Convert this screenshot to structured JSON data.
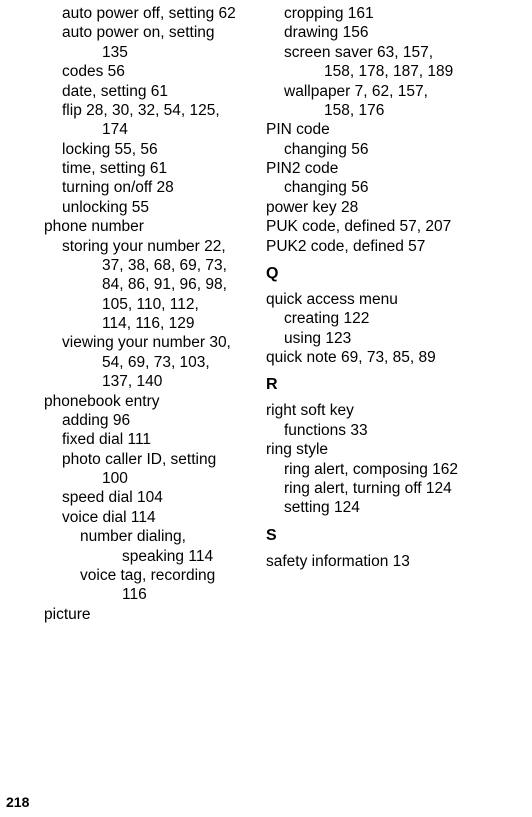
{
  "left": {
    "e0": "auto power off, setting  62",
    "e1": "auto power on, setting",
    "e1c": "135",
    "e2": "codes  56",
    "e3": "date, setting  61",
    "e4": "flip  28, 30, 32, 54, 125,",
    "e4c": "174",
    "e5": "locking  55, 56",
    "e6": "time, setting  61",
    "e7": "turning on/off  28",
    "e8": "unlocking  55",
    "h1": "phone number",
    "e9": "storing your number  22,",
    "e9c1": "37, 38, 68, 69, 73,",
    "e9c2": "84, 86, 91, 96, 98,",
    "e9c3": "105, 110, 112,",
    "e9c4": "114, 116, 129",
    "e10": "viewing your number  30,",
    "e10c1": "54, 69, 73, 103,",
    "e10c2": "137, 140",
    "h2": "phonebook entry",
    "e11": "adding  96",
    "e12": "fixed dial  111",
    "e13": "photo caller ID, setting",
    "e13c": "100",
    "e14": "speed dial  104",
    "e15": "voice dial  114",
    "e16": "number dialing,",
    "e16c": "speaking  114",
    "e17": "voice tag, recording",
    "e17c": "116",
    "h3": "picture"
  },
  "right": {
    "e0": "cropping  161",
    "e1": "drawing  156",
    "e2": "screen saver  63, 157,",
    "e2c": "158, 178, 187, 189",
    "e3": "wallpaper  7, 62, 157,",
    "e3c": "158, 176",
    "h1": "PIN code",
    "e4": "changing  56",
    "h2": "PIN2 code",
    "e5": "changing  56",
    "e6": "power key  28",
    "e7": "PUK code, defined  57, 207",
    "e8": "PUK2 code, defined  57",
    "secQ": "Q",
    "h3": "quick access menu",
    "e9": "creating  122",
    "e10": "using  123",
    "e11": "quick note  69, 73, 85, 89",
    "secR": "R",
    "h4": "right soft key",
    "e12": "functions  33",
    "h5": "ring style",
    "e13": "ring alert, composing  162",
    "e14": "ring alert, turning off  124",
    "e15": "setting  124",
    "secS": "S",
    "e16": "safety information  13"
  },
  "pagenum": "218"
}
